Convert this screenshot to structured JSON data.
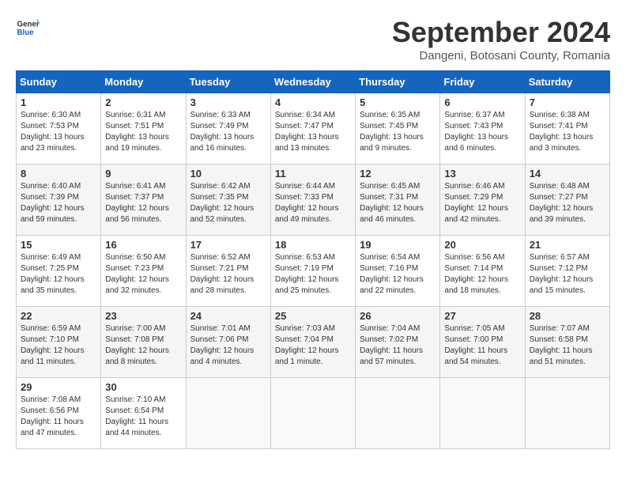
{
  "header": {
    "logo_general": "General",
    "logo_blue": "Blue",
    "month_title": "September 2024",
    "subtitle": "Dangeni, Botosani County, Romania"
  },
  "weekdays": [
    "Sunday",
    "Monday",
    "Tuesday",
    "Wednesday",
    "Thursday",
    "Friday",
    "Saturday"
  ],
  "weeks": [
    [
      {
        "day": "1",
        "sunrise": "6:30 AM",
        "sunset": "7:53 PM",
        "daylight": "13 hours and 23 minutes."
      },
      {
        "day": "2",
        "sunrise": "6:31 AM",
        "sunset": "7:51 PM",
        "daylight": "13 hours and 19 minutes."
      },
      {
        "day": "3",
        "sunrise": "6:33 AM",
        "sunset": "7:49 PM",
        "daylight": "13 hours and 16 minutes."
      },
      {
        "day": "4",
        "sunrise": "6:34 AM",
        "sunset": "7:47 PM",
        "daylight": "13 hours and 13 minutes."
      },
      {
        "day": "5",
        "sunrise": "6:35 AM",
        "sunset": "7:45 PM",
        "daylight": "13 hours and 9 minutes."
      },
      {
        "day": "6",
        "sunrise": "6:37 AM",
        "sunset": "7:43 PM",
        "daylight": "13 hours and 6 minutes."
      },
      {
        "day": "7",
        "sunrise": "6:38 AM",
        "sunset": "7:41 PM",
        "daylight": "13 hours and 3 minutes."
      }
    ],
    [
      {
        "day": "8",
        "sunrise": "6:40 AM",
        "sunset": "7:39 PM",
        "daylight": "12 hours and 59 minutes."
      },
      {
        "day": "9",
        "sunrise": "6:41 AM",
        "sunset": "7:37 PM",
        "daylight": "12 hours and 56 minutes."
      },
      {
        "day": "10",
        "sunrise": "6:42 AM",
        "sunset": "7:35 PM",
        "daylight": "12 hours and 52 minutes."
      },
      {
        "day": "11",
        "sunrise": "6:44 AM",
        "sunset": "7:33 PM",
        "daylight": "12 hours and 49 minutes."
      },
      {
        "day": "12",
        "sunrise": "6:45 AM",
        "sunset": "7:31 PM",
        "daylight": "12 hours and 46 minutes."
      },
      {
        "day": "13",
        "sunrise": "6:46 AM",
        "sunset": "7:29 PM",
        "daylight": "12 hours and 42 minutes."
      },
      {
        "day": "14",
        "sunrise": "6:48 AM",
        "sunset": "7:27 PM",
        "daylight": "12 hours and 39 minutes."
      }
    ],
    [
      {
        "day": "15",
        "sunrise": "6:49 AM",
        "sunset": "7:25 PM",
        "daylight": "12 hours and 35 minutes."
      },
      {
        "day": "16",
        "sunrise": "6:50 AM",
        "sunset": "7:23 PM",
        "daylight": "12 hours and 32 minutes."
      },
      {
        "day": "17",
        "sunrise": "6:52 AM",
        "sunset": "7:21 PM",
        "daylight": "12 hours and 28 minutes."
      },
      {
        "day": "18",
        "sunrise": "6:53 AM",
        "sunset": "7:19 PM",
        "daylight": "12 hours and 25 minutes."
      },
      {
        "day": "19",
        "sunrise": "6:54 AM",
        "sunset": "7:16 PM",
        "daylight": "12 hours and 22 minutes."
      },
      {
        "day": "20",
        "sunrise": "6:56 AM",
        "sunset": "7:14 PM",
        "daylight": "12 hours and 18 minutes."
      },
      {
        "day": "21",
        "sunrise": "6:57 AM",
        "sunset": "7:12 PM",
        "daylight": "12 hours and 15 minutes."
      }
    ],
    [
      {
        "day": "22",
        "sunrise": "6:59 AM",
        "sunset": "7:10 PM",
        "daylight": "12 hours and 11 minutes."
      },
      {
        "day": "23",
        "sunrise": "7:00 AM",
        "sunset": "7:08 PM",
        "daylight": "12 hours and 8 minutes."
      },
      {
        "day": "24",
        "sunrise": "7:01 AM",
        "sunset": "7:06 PM",
        "daylight": "12 hours and 4 minutes."
      },
      {
        "day": "25",
        "sunrise": "7:03 AM",
        "sunset": "7:04 PM",
        "daylight": "12 hours and 1 minute."
      },
      {
        "day": "26",
        "sunrise": "7:04 AM",
        "sunset": "7:02 PM",
        "daylight": "11 hours and 57 minutes."
      },
      {
        "day": "27",
        "sunrise": "7:05 AM",
        "sunset": "7:00 PM",
        "daylight": "11 hours and 54 minutes."
      },
      {
        "day": "28",
        "sunrise": "7:07 AM",
        "sunset": "6:58 PM",
        "daylight": "11 hours and 51 minutes."
      }
    ],
    [
      {
        "day": "29",
        "sunrise": "7:08 AM",
        "sunset": "6:56 PM",
        "daylight": "11 hours and 47 minutes."
      },
      {
        "day": "30",
        "sunrise": "7:10 AM",
        "sunset": "6:54 PM",
        "daylight": "11 hours and 44 minutes."
      },
      null,
      null,
      null,
      null,
      null
    ]
  ]
}
